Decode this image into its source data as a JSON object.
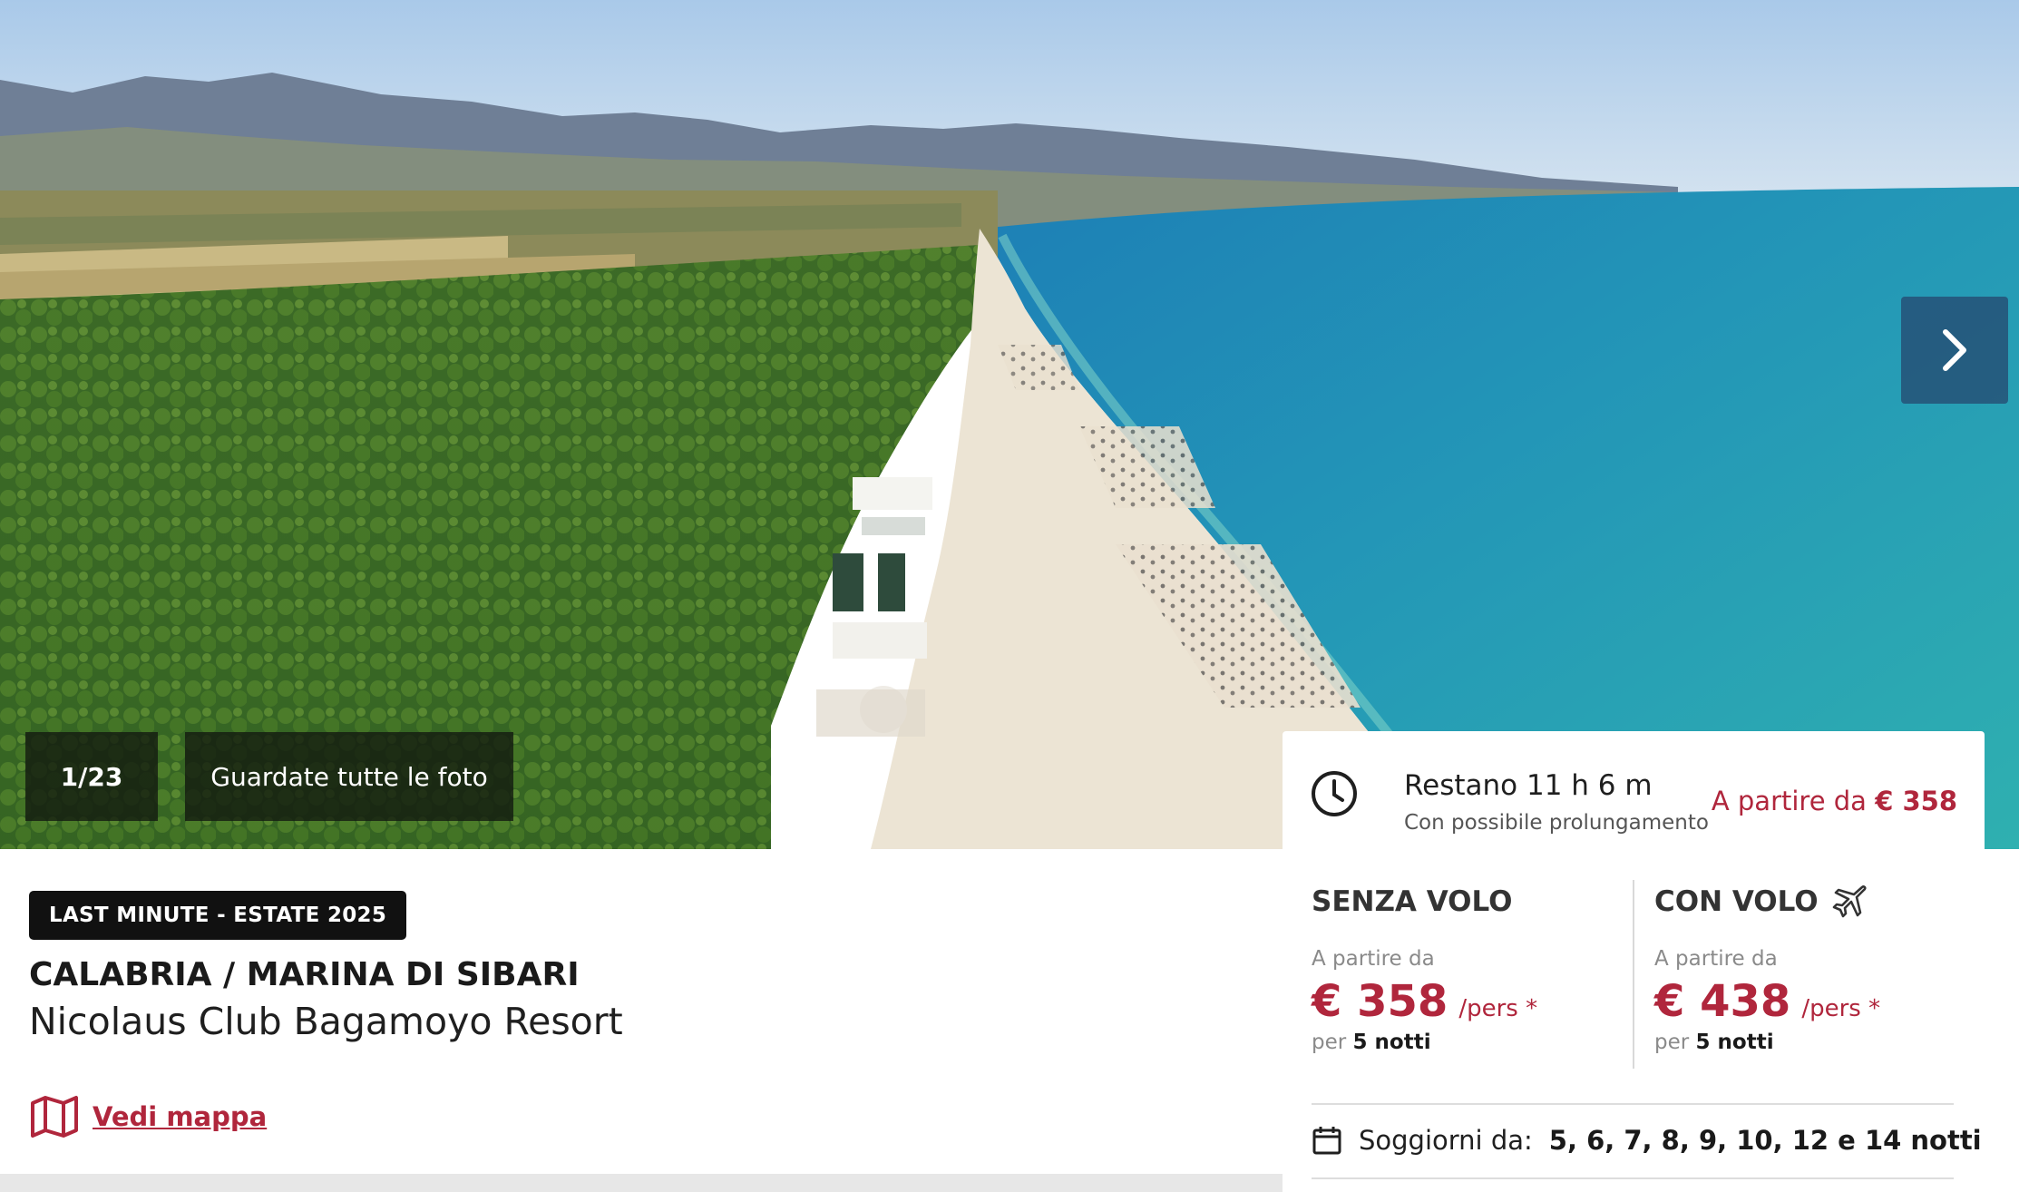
{
  "gallery": {
    "counter": "1/23",
    "all_photos_label": "Guardate tutte le foto",
    "next_icon": "chevron-right-icon"
  },
  "listing": {
    "badge": "LAST MINUTE - ESTATE 2025",
    "location": "CALABRIA / MARINA DI SIBARI",
    "hotel_name": "Nicolaus Club Bagamoyo Resort",
    "map_link": "Vedi mappa",
    "map_icon": "map-icon"
  },
  "booking": {
    "countdown_title": "Restano 11 h 6 m",
    "countdown_sub": "Con possibile prolungamento",
    "from_price_prefix": "A partire da",
    "from_price_value": "€ 358",
    "without_flight": {
      "title": "SENZA VOLO",
      "from_label": "A partire da",
      "price": "€ 358",
      "unit": "/pers *",
      "nights_prefix": "per",
      "nights": "5 notti"
    },
    "with_flight": {
      "title": "CON VOLO",
      "from_label": "A partire da",
      "price": "€ 438",
      "unit": "/pers *",
      "nights_prefix": "per",
      "nights": "5 notti"
    },
    "stays_label": "Soggiorni da:",
    "stays_value": "5, 6, 7, 8, 9, 10, 12 e 14 notti"
  },
  "colors": {
    "accent": "#b0263c",
    "badge_bg": "#111111",
    "nav_button_bg": "#26446c"
  }
}
